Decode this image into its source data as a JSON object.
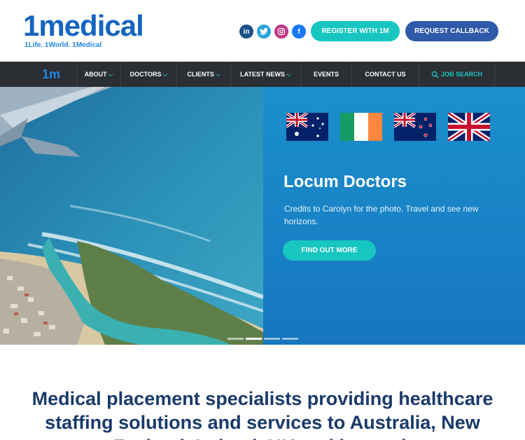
{
  "brand": {
    "logo_text": "1medical",
    "tagline": "1Life. 1World. 1Medical",
    "nav_logo": "1m"
  },
  "social": {
    "linkedin": "in",
    "twitter": "t",
    "instagram": "◎",
    "facebook": "f"
  },
  "header": {
    "register_label": "REGISTER WITH 1M",
    "callback_label": "REQUEST CALLBACK"
  },
  "nav": {
    "items": [
      {
        "label": "ABOUT"
      },
      {
        "label": "DOCTORS"
      },
      {
        "label": "CLIENTS"
      },
      {
        "label": "LATEST NEWS"
      },
      {
        "label": "EVENTS"
      },
      {
        "label": "CONTACT US"
      },
      {
        "label": "JOB SEARCH"
      }
    ]
  },
  "hero": {
    "title": "Locum Doctors",
    "description": "Credits to Carolyn for the photo. Travel and see new horizons.",
    "cta_label": "FIND OUT MORE",
    "flags": [
      "australia-flag",
      "ireland-flag",
      "new-zealand-flag",
      "uk-flag"
    ],
    "slides_total": 4,
    "active_slide": 2
  },
  "intro": {
    "heading": "Medical placement specialists providing healthcare staffing solutions and services to Australia, New Zealand, Ireland, UK and beyond."
  },
  "colors": {
    "brand_blue": "#1565c0",
    "teal": "#17c6c0",
    "navy_button": "#2e5aa9",
    "nav_bg": "#2b2e33",
    "panel_blue": "#1a90cc",
    "heading_navy": "#1a3a6b"
  }
}
